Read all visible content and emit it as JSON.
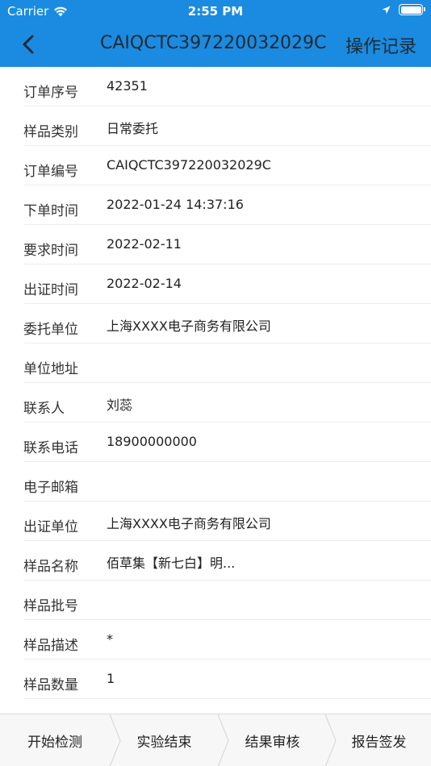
{
  "status_bar": {
    "carrier": "Carrier",
    "time": "2:55 PM",
    "icons": [
      "wifi-icon",
      "location-arrow-icon",
      "battery-icon"
    ]
  },
  "nav": {
    "title": "CAIQCTC397220032029C",
    "action_label": "操作记录",
    "back_icon": "chevron-left-icon",
    "bar_color": "#1a8be0"
  },
  "fields": [
    {
      "label": "订单序号",
      "value": "42351"
    },
    {
      "label": "样品类别",
      "value": "日常委托"
    },
    {
      "label": "订单编号",
      "value": "CAIQCTC397220032029C"
    },
    {
      "label": "下单时间",
      "value": "2022-01-24 14:37:16"
    },
    {
      "label": "要求时间",
      "value": "2022-02-11"
    },
    {
      "label": "出证时间",
      "value": "2022-02-14"
    },
    {
      "label": "委托单位",
      "value": "上海XXXX电子商务有限公司"
    },
    {
      "label": "单位地址",
      "value": ""
    },
    {
      "label": "联系人",
      "value": "刘蕊"
    },
    {
      "label": "联系电话",
      "value": "18900000000"
    },
    {
      "label": "电子邮箱",
      "value": ""
    },
    {
      "label": "出证单位",
      "value": "上海XXXX电子商务有限公司"
    },
    {
      "label": "样品名称",
      "value": "佰草集【新七白】明..."
    },
    {
      "label": "样品批号",
      "value": ""
    },
    {
      "label": "样品描述",
      "value": "*"
    },
    {
      "label": "样品数量",
      "value": "1"
    }
  ],
  "workflow_tabs": [
    {
      "label": "开始检测"
    },
    {
      "label": "实验结束"
    },
    {
      "label": "结果审核"
    },
    {
      "label": "报告签发"
    }
  ]
}
